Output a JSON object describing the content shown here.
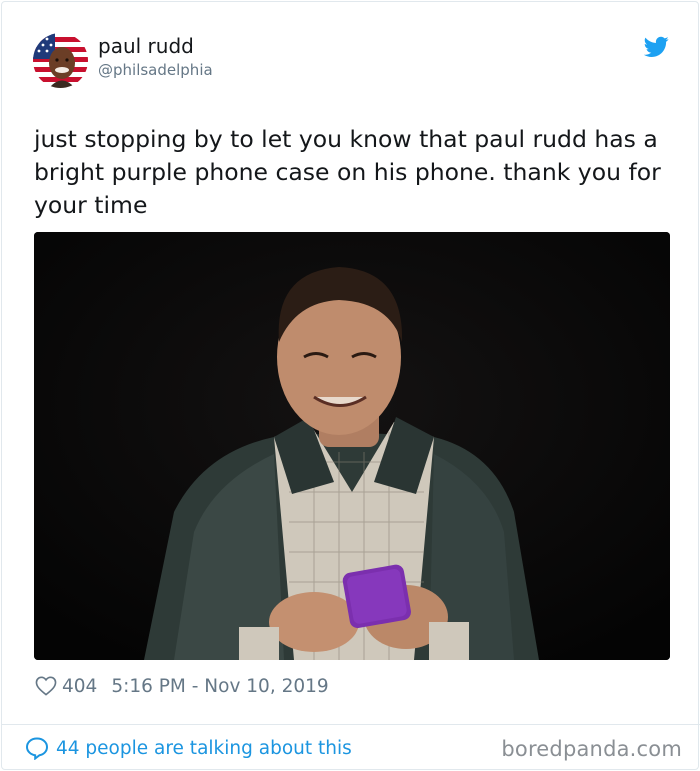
{
  "tweet": {
    "display_name": "paul rudd",
    "handle": "@philsadelphia",
    "text": "just stopping by to let you know that paul rudd has a bright purple phone case on his phone. thank you for your time",
    "likes": "404",
    "timestamp": "5:16 PM - Nov 10, 2019",
    "conversation": "44 people are talking about this"
  },
  "icons": {
    "platform": "twitter-bird-icon",
    "like": "heart-icon",
    "reply": "speech-bubble-icon"
  },
  "colors": {
    "twitter_blue": "#1da1f2",
    "link_blue": "#1b95e0",
    "meta_gray": "#657786",
    "phone_case_purple": "#7b2fae"
  },
  "watermark": "boredpanda.com"
}
